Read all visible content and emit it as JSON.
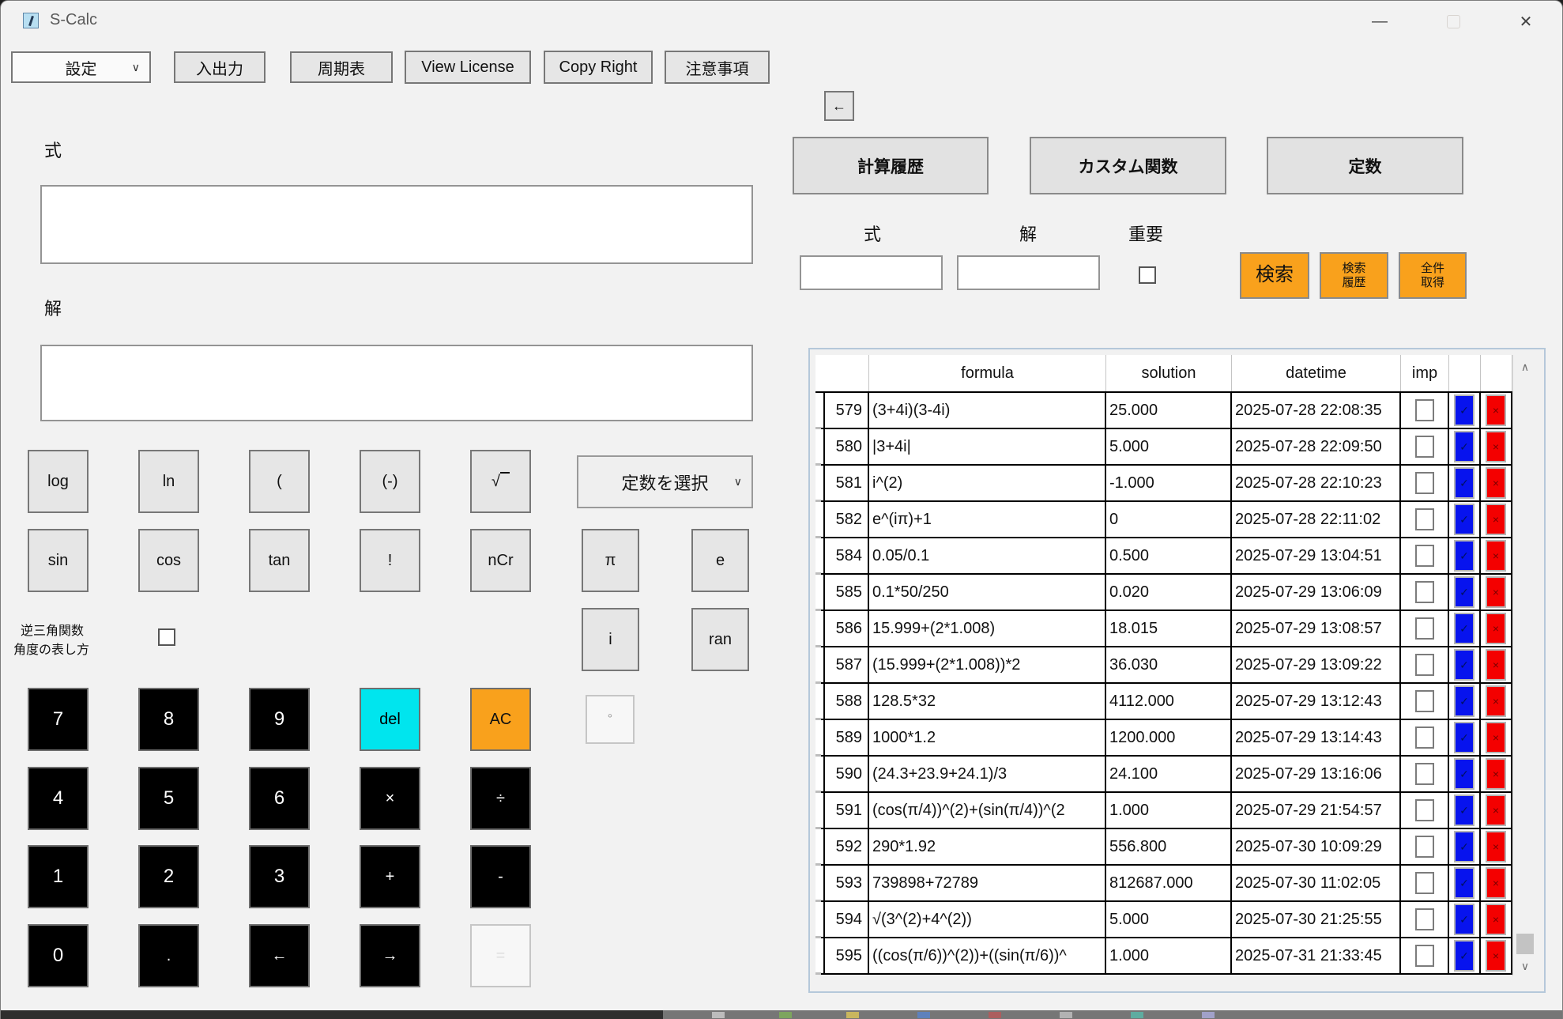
{
  "window": {
    "title": "S-Calc",
    "controls": {
      "minimize_glyph": "—",
      "close_glyph": "✕"
    }
  },
  "toolbar": {
    "settings": "設定",
    "io": "入出力",
    "periodic": "周期表",
    "license": "View License",
    "copyright": "Copy Right",
    "notes": "注意事項"
  },
  "calc": {
    "formula_label": "式",
    "solution_label": "解",
    "constants_dropdown": "定数を選択",
    "inverse_label1": "逆三角関数",
    "inverse_label2": "角度の表し方",
    "fn": {
      "log": "log",
      "ln": "ln",
      "open_paren": "(",
      "negate": "(-)",
      "sqrt": "√",
      "sin": "sin",
      "cos": "cos",
      "tan": "tan",
      "factorial": "!",
      "ncr": "nCr",
      "pi": "π",
      "e": "e",
      "i": "i",
      "ran": "ran",
      "degree": "°"
    },
    "keys": {
      "k7": "7",
      "k8": "8",
      "k9": "9",
      "del": "del",
      "ac": "AC",
      "k4": "4",
      "k5": "5",
      "k6": "6",
      "mul": "×",
      "div": "÷",
      "k1": "1",
      "k2": "2",
      "k3": "3",
      "plus": "+",
      "minus": "-",
      "k0": "0",
      "dot": ".",
      "left": "←",
      "right": "→",
      "eq": "="
    }
  },
  "panel": {
    "back": "←",
    "history_tab": "計算履歴",
    "custom_tab": "カスタム関数",
    "constants_tab": "定数",
    "search": {
      "formula_label": "式",
      "solution_label": "解",
      "important_label": "重要",
      "formula_value": "",
      "solution_value": "",
      "important_checked": false,
      "search_button": "検索",
      "search_history_line1": "検索",
      "search_history_line2": "履歴",
      "fetch_all_line1": "全件",
      "fetch_all_line2": "取得"
    }
  },
  "table": {
    "headers": {
      "formula": "formula",
      "solution": "solution",
      "datetime": "datetime",
      "imp": "imp"
    },
    "icons": {
      "apply_glyph": "✓",
      "delete_glyph": "×"
    },
    "scrollbar": {
      "up_glyph": "∧",
      "down_glyph": "∨"
    },
    "rows": [
      {
        "id": "579",
        "formula": "(3+4i)(3-4i)",
        "solution": "25.000",
        "datetime": "2025-07-28 22:08:35",
        "imp": false
      },
      {
        "id": "580",
        "formula": "|3+4i|",
        "solution": "5.000",
        "datetime": "2025-07-28 22:09:50",
        "imp": false
      },
      {
        "id": "581",
        "formula": "i^(2)",
        "solution": "-1.000",
        "datetime": "2025-07-28 22:10:23",
        "imp": false
      },
      {
        "id": "582",
        "formula": "e^(iπ)+1",
        "solution": "0",
        "datetime": "2025-07-28 22:11:02",
        "imp": false
      },
      {
        "id": "584",
        "formula": "0.05/0.1",
        "solution": "0.500",
        "datetime": "2025-07-29 13:04:51",
        "imp": false
      },
      {
        "id": "585",
        "formula": "0.1*50/250",
        "solution": "0.020",
        "datetime": "2025-07-29 13:06:09",
        "imp": false
      },
      {
        "id": "586",
        "formula": "15.999+(2*1.008)",
        "solution": "18.015",
        "datetime": "2025-07-29 13:08:57",
        "imp": false
      },
      {
        "id": "587",
        "formula": "(15.999+(2*1.008))*2",
        "solution": "36.030",
        "datetime": "2025-07-29 13:09:22",
        "imp": false
      },
      {
        "id": "588",
        "formula": "128.5*32",
        "solution": "4112.000",
        "datetime": "2025-07-29 13:12:43",
        "imp": false
      },
      {
        "id": "589",
        "formula": "1000*1.2",
        "solution": "1200.000",
        "datetime": "2025-07-29 13:14:43",
        "imp": false
      },
      {
        "id": "590",
        "formula": "(24.3+23.9+24.1)/3",
        "solution": "24.100",
        "datetime": "2025-07-29 13:16:06",
        "imp": false
      },
      {
        "id": "591",
        "formula": "(cos(π/4))^(2)+(sin(π/4))^(2",
        "solution": "1.000",
        "datetime": "2025-07-29 21:54:57",
        "imp": false
      },
      {
        "id": "592",
        "formula": "290*1.92",
        "solution": "556.800",
        "datetime": "2025-07-30 10:09:29",
        "imp": false
      },
      {
        "id": "593",
        "formula": "739898+72789",
        "solution": "812687.000",
        "datetime": "2025-07-30 11:02:05",
        "imp": false
      },
      {
        "id": "594",
        "formula": "√(3^(2)+4^(2))",
        "solution": "5.000",
        "datetime": "2025-07-30 21:25:55",
        "imp": false
      },
      {
        "id": "595",
        "formula": "((cos(π/6))^(2))+((sin(π/6))^",
        "solution": "1.000",
        "datetime": "2025-07-31 21:33:45",
        "imp": false
      }
    ]
  },
  "colors": {
    "accent_orange": "#f9a11c",
    "key_cyan": "#00e5ee",
    "apply_blue": "#0713ee",
    "delete_red": "#f40000"
  }
}
